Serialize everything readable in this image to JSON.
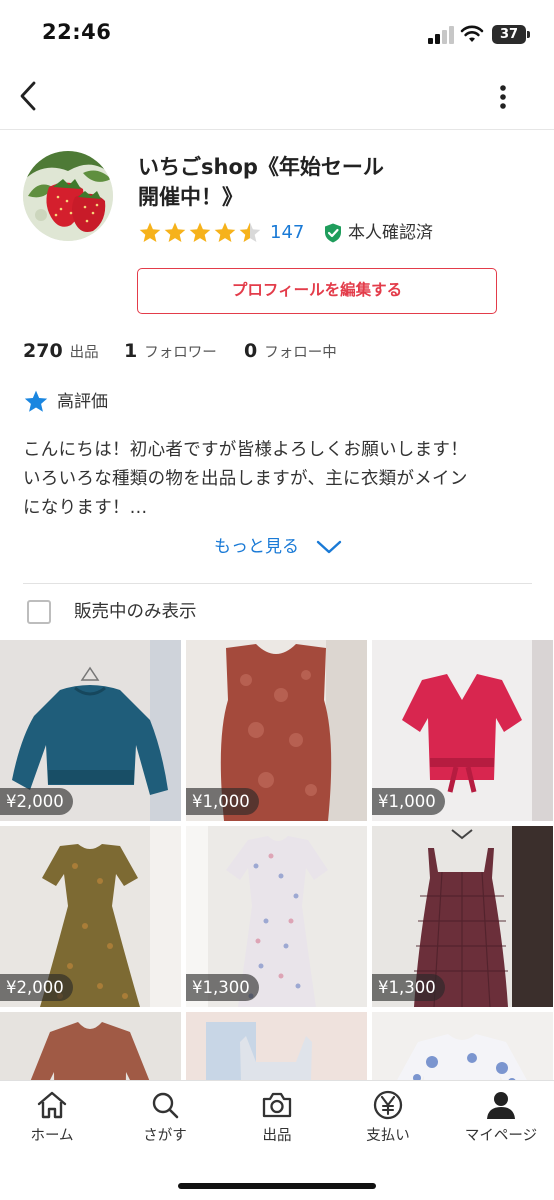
{
  "status_bar": {
    "time": "22:46",
    "battery": "37"
  },
  "header": {
    "back_icon": "chevron-left-icon",
    "more_icon": "vertical-dots-icon"
  },
  "profile": {
    "shop_name_line1": "いちごshop《年始セール",
    "shop_name_line2": "開催中！》",
    "rating": 4.5,
    "rating_count": "147",
    "verified_label": "本人確認済",
    "edit_button": "プロフィールを編集する"
  },
  "stats": [
    {
      "value": "270",
      "label": "出品"
    },
    {
      "value": "1",
      "label": "フォロワー"
    },
    {
      "value": "0",
      "label": "フォロー中"
    }
  ],
  "badge": {
    "label": "高評価"
  },
  "intro": {
    "line1": "こんにちは！初心者ですが皆様よろしくお願いします！",
    "line2": "いろいろな種類の物を出品しますが、主に衣類がメイン",
    "line3": "になります！...",
    "see_more": "もっと見る"
  },
  "filter": {
    "label": "販売中のみ表示",
    "checked": false
  },
  "items": [
    {
      "price": "¥2,000",
      "color": "#1f5d7a"
    },
    {
      "price": "¥1,000",
      "color": "#a44a3c"
    },
    {
      "price": "¥1,000",
      "color": "#d8264f"
    },
    {
      "price": "¥2,000",
      "color": "#7d6a33"
    },
    {
      "price": "¥1,300",
      "color": "#e9e4ea"
    },
    {
      "price": "¥1,300",
      "color": "#6b2f3a"
    },
    {
      "price": "",
      "color": "#a05a45"
    },
    {
      "price": "",
      "color": "#dfe3ea"
    },
    {
      "price": "",
      "color": "#7b95cf"
    }
  ],
  "tabs": [
    {
      "label": "ホーム",
      "icon": "home-icon"
    },
    {
      "label": "さがす",
      "icon": "search-icon"
    },
    {
      "label": "出品",
      "icon": "camera-icon"
    },
    {
      "label": "支払い",
      "icon": "yen-icon"
    },
    {
      "label": "マイページ",
      "icon": "person-icon"
    }
  ],
  "colors": {
    "accent_red": "#e33c4a",
    "link_blue": "#1a7ad6",
    "star_yellow": "#f6b21b",
    "verified_green": "#1f9d5c"
  }
}
